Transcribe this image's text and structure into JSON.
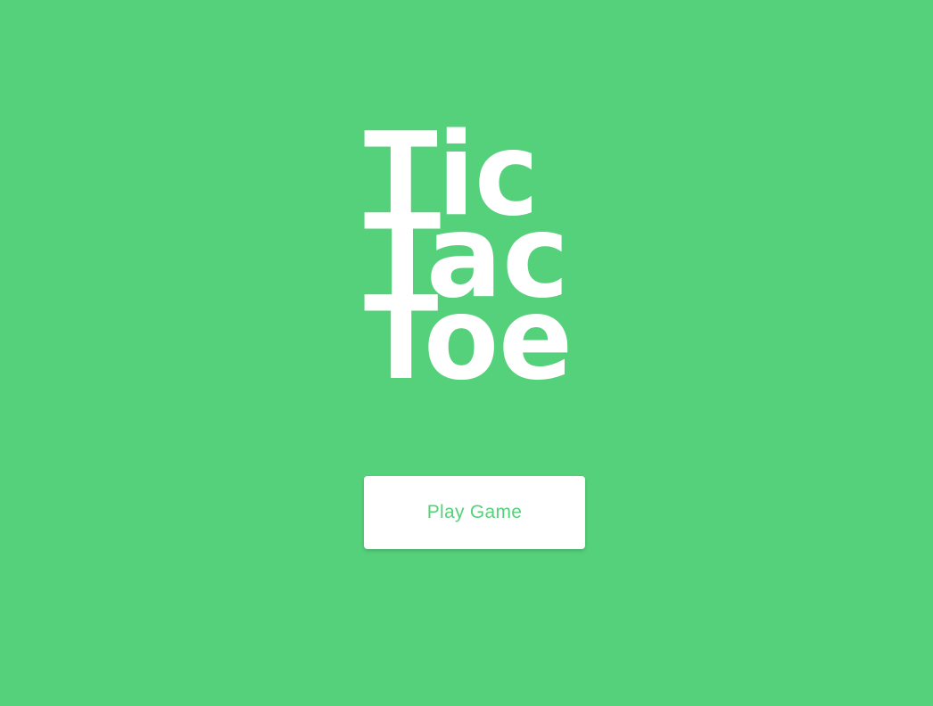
{
  "logo": {
    "line1": "Tic",
    "line2": "Tac",
    "line3": "Toe"
  },
  "play_button": {
    "label": "Play Game"
  },
  "colors": {
    "background": "#56d17b",
    "logo_text": "#ffffff",
    "button_bg": "#ffffff",
    "button_text": "#56d17b"
  }
}
